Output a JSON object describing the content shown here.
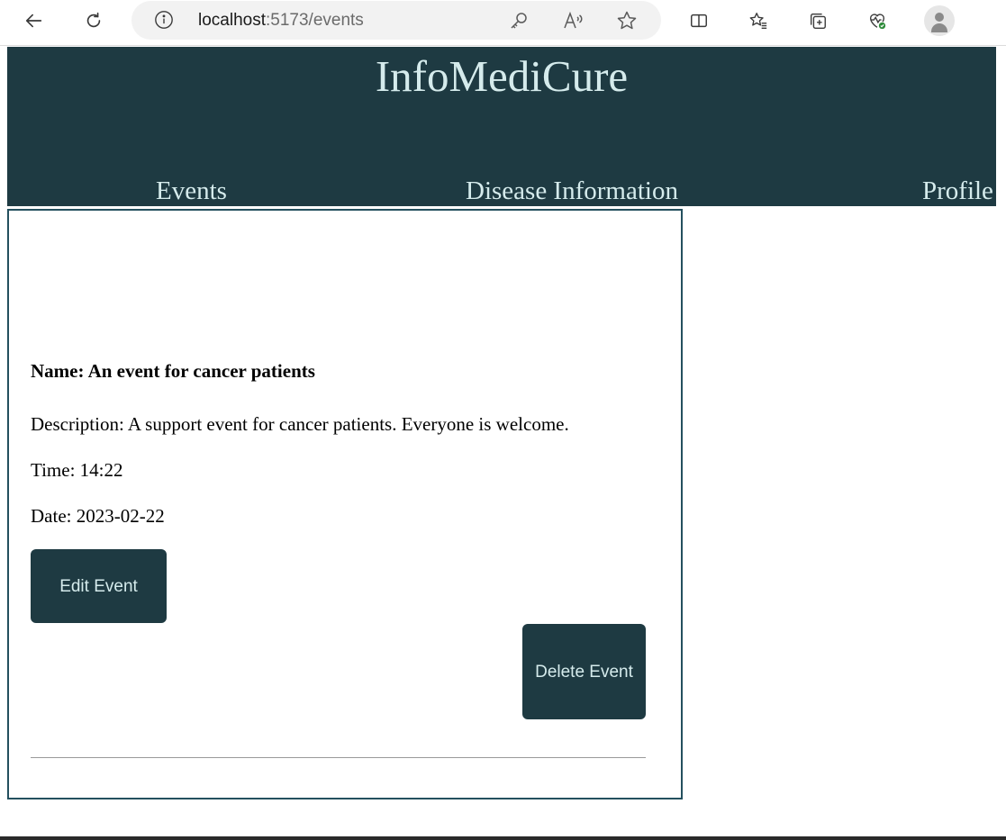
{
  "browser": {
    "url_host": "localhost",
    "url_path": ":5173/events",
    "icons": [
      "back-icon",
      "refresh-icon",
      "info-icon",
      "key-icon",
      "read-aloud-icon",
      "favorite-star-icon",
      "split-screen-icon",
      "favorites-icon",
      "collections-icon",
      "browser-essentials-icon",
      "profile-icon"
    ]
  },
  "site": {
    "title": "InfoMediCure",
    "nav": [
      "Events",
      "Disease Information",
      "Profile"
    ]
  },
  "event": {
    "name": "Name: An event for cancer patients",
    "description": "Description: A support event for cancer patients. Everyone is welcome.",
    "time": "Time: 14:22",
    "date": "Date: 2023-02-22",
    "edit_label": "Edit Event",
    "delete_label": "Delete Event"
  },
  "colors": {
    "header_bg": "#1e3a42",
    "header_text": "#d5ebec",
    "card_border": "#24505e"
  }
}
